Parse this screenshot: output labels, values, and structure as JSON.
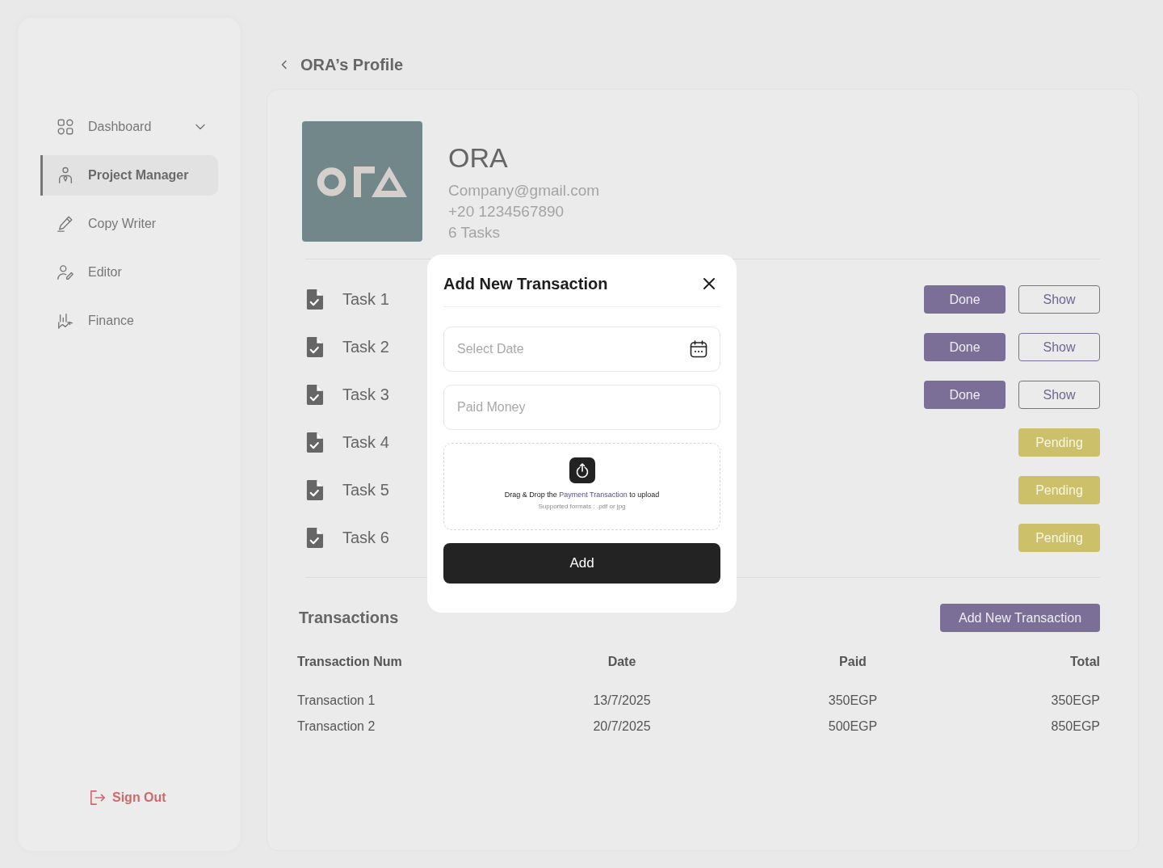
{
  "sidebar": {
    "items": [
      {
        "label": "Dashboard",
        "kind": "dropdown",
        "selected": false
      },
      {
        "label": "Project Manager",
        "kind": "link",
        "selected": true
      },
      {
        "label": "Copy Writer",
        "kind": "link",
        "selected": false
      },
      {
        "label": "Editor",
        "kind": "link",
        "selected": false
      },
      {
        "label": "Finance",
        "kind": "link",
        "selected": false
      }
    ],
    "sign_out": "Sign Out"
  },
  "page": {
    "title": "ORA’s Profile"
  },
  "profile": {
    "name": "ORA",
    "email": "Company@gmail.com",
    "phone": "+20 1234567890",
    "task_count": "6 Tasks"
  },
  "tasks": [
    {
      "label": "Task 1",
      "kind": "done",
      "status": "Done",
      "action": "Show"
    },
    {
      "label": "Task 2",
      "kind": "done",
      "status": "Done",
      "action": "Show"
    },
    {
      "label": "Task 3",
      "kind": "done",
      "status": "Done",
      "action": "Show"
    },
    {
      "label": "Task 4",
      "kind": "pending",
      "status": "Pending"
    },
    {
      "label": "Task 5",
      "kind": "pending",
      "status": "Pending"
    },
    {
      "label": "Task 6",
      "kind": "pending",
      "status": "Pending"
    }
  ],
  "transactions": {
    "title": "Transactions",
    "add_button": "Add New Transaction",
    "columns": [
      "Transaction Num",
      "Date",
      "Paid",
      "Total"
    ],
    "rows": [
      [
        "Transaction 1",
        "13/7/2025",
        "350EGP",
        "350EGP"
      ],
      [
        "Transaction 2",
        "20/7/2025",
        "500EGP",
        "850EGP"
      ]
    ]
  },
  "modal": {
    "title": "Add New Transaction",
    "date_field": {
      "placeholder": "Select Date"
    },
    "paid_field": {
      "placeholder": "Paid Money"
    },
    "upload": {
      "prompt_start": "Drag & Drop the",
      "link": "Payment Transaction",
      "prompt_end": "to upload",
      "hint": "Supported formats : .pdf or jpg"
    },
    "submit": "Add"
  }
}
